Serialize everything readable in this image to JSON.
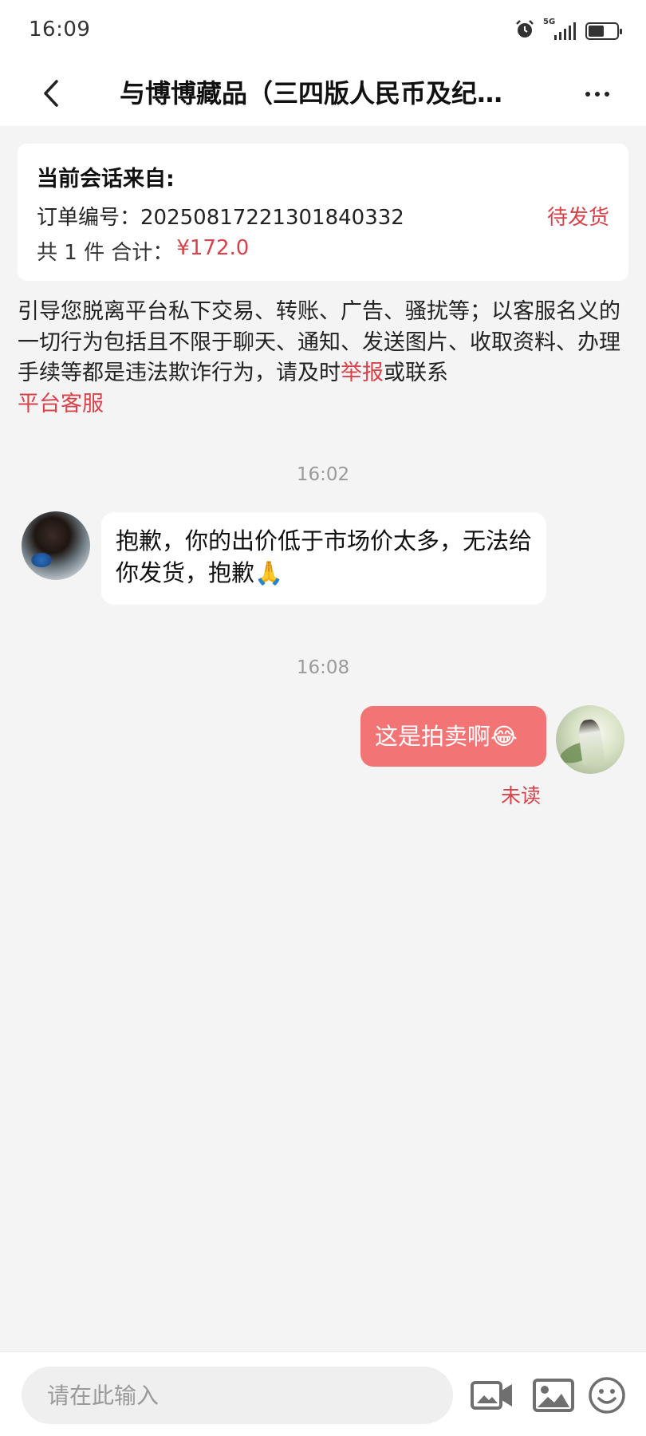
{
  "status_bar": {
    "time": "16:09",
    "network": "5G",
    "icons": [
      "alarm-icon",
      "signal-icon",
      "battery-icon"
    ]
  },
  "header": {
    "title": "与博博藏品（三四版人民币及纪…",
    "back_icon": "chevron-left-icon",
    "more_icon": "more-dots-icon"
  },
  "order_card": {
    "heading": "当前会话来自:",
    "order_number": "订单编号：20250817221301840332",
    "status": "待发货",
    "summary_prefix": "共 1 件 合计：",
    "total": "¥172.0"
  },
  "warning": {
    "text_before": "引导您脱离平台私下交易、转账、广告、骚扰等；以客服名义的一切行为包括且不限于聊天、通知、发送图片、收取资料、办理手续等都是违法欺诈行为，请及时",
    "report_link": "举报",
    "text_middle": "或联系",
    "service_link": "平台客服"
  },
  "messages": [
    {
      "timestamp": "16:02",
      "side": "left",
      "text": "抱歉，你的出价低于市场价太多，无法给你发货，抱歉🙏"
    },
    {
      "timestamp": "16:08",
      "side": "right",
      "text": "这是拍卖啊😂",
      "read_status": "未读"
    }
  ],
  "input_bar": {
    "placeholder": "请在此输入",
    "tools": [
      "video-camera-icon",
      "image-icon",
      "emoji-icon"
    ]
  },
  "colors": {
    "accent_red": "#d9424a",
    "own_bubble": "#f27474",
    "background": "#f4f4f4"
  }
}
